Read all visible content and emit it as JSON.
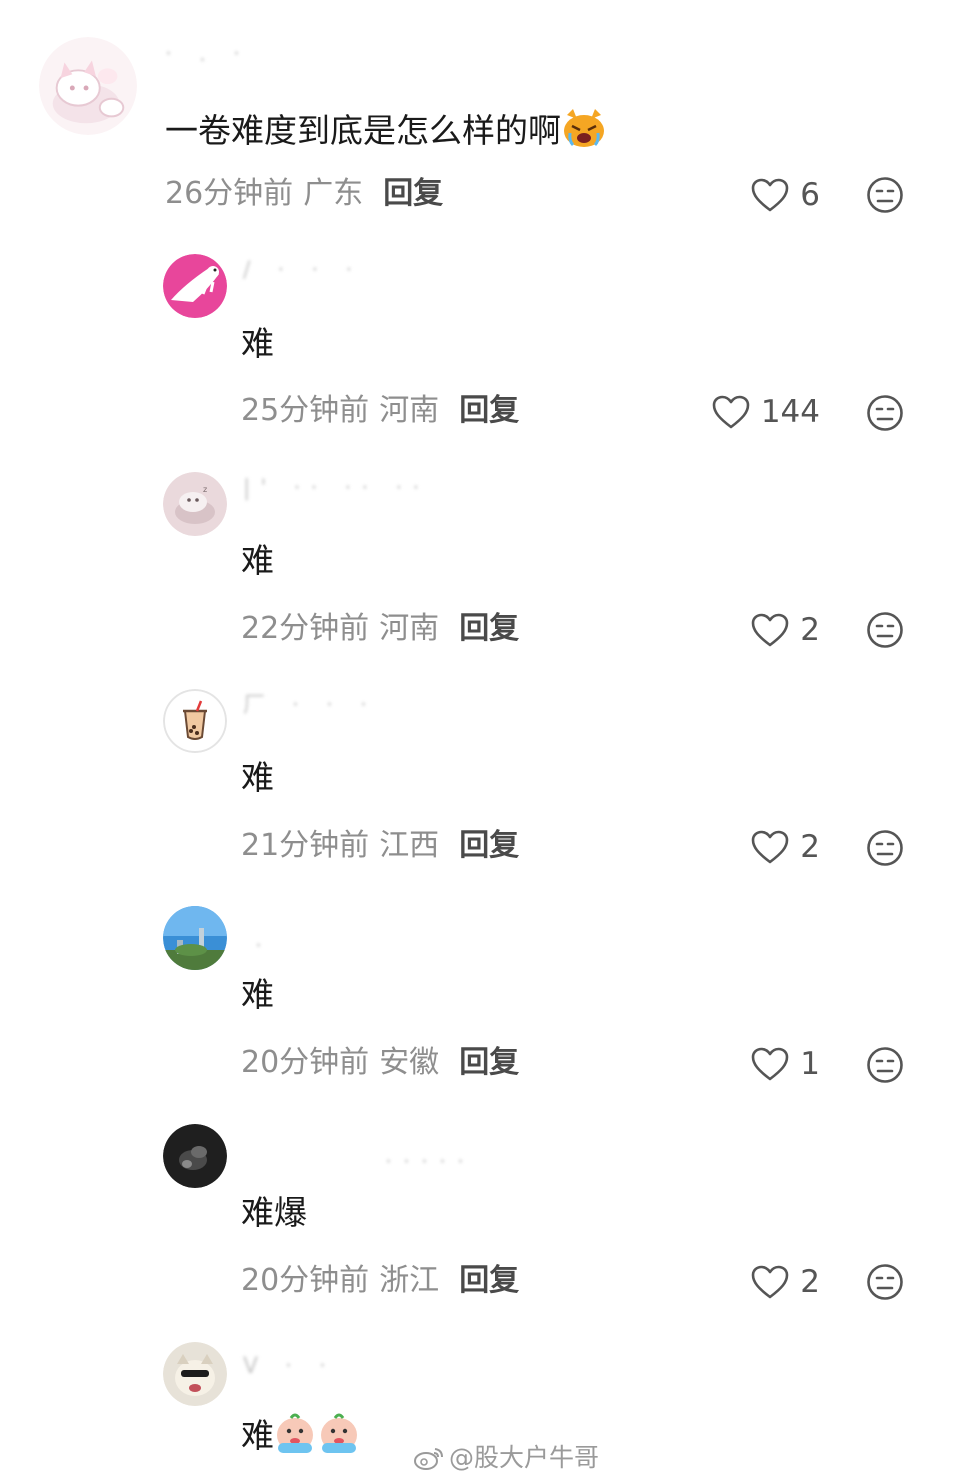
{
  "comments": [
    {
      "name": "·  .  ·  ",
      "text": "一卷难度到底是怎么样的啊",
      "time": "26分钟前",
      "location": "广东",
      "reply": "回复",
      "likes": "6"
    },
    {
      "name": "/  ·  ·  ·",
      "text": "难",
      "time": "25分钟前",
      "location": "河南",
      "reply": "回复",
      "likes": "144"
    },
    {
      "name": "|'  ··  ··  ··  ··",
      "text": "难",
      "time": "22分钟前",
      "location": "河南",
      "reply": "回复",
      "likes": "2"
    },
    {
      "name": "厂 ·  ·  ·",
      "text": "难",
      "time": "21分钟前",
      "location": "江西",
      "reply": "回复",
      "likes": "2"
    },
    {
      "name": "·",
      "text": "难",
      "time": "20分钟前",
      "location": "安徽",
      "reply": "回复",
      "likes": "1"
    },
    {
      "name": "· · ·  · · ·  ·· · ·",
      "text": "难爆",
      "time": "20分钟前",
      "location": "浙江",
      "reply": "回复",
      "likes": "2"
    },
    {
      "name": "V  ·  ·",
      "text": "难",
      "time": "",
      "location": "",
      "reply": "",
      "likes": ""
    }
  ],
  "icons": {
    "like": "heart-outline-icon",
    "dislike": "meh-face-icon",
    "emoji_cat": "crying-cat-emoji",
    "emoji_crying": "crying-face-emoji",
    "weibo": "weibo-logo-icon"
  },
  "colors": {
    "primary_text": "#1a1a1a",
    "meta_text": "#8e8e8e",
    "reply_text": "#4a4a4a",
    "icon": "#555555",
    "avatar_pink": "#e8469b",
    "emoji_orange": "#f5a623"
  },
  "watermark": {
    "text": "@股大户牛哥"
  }
}
